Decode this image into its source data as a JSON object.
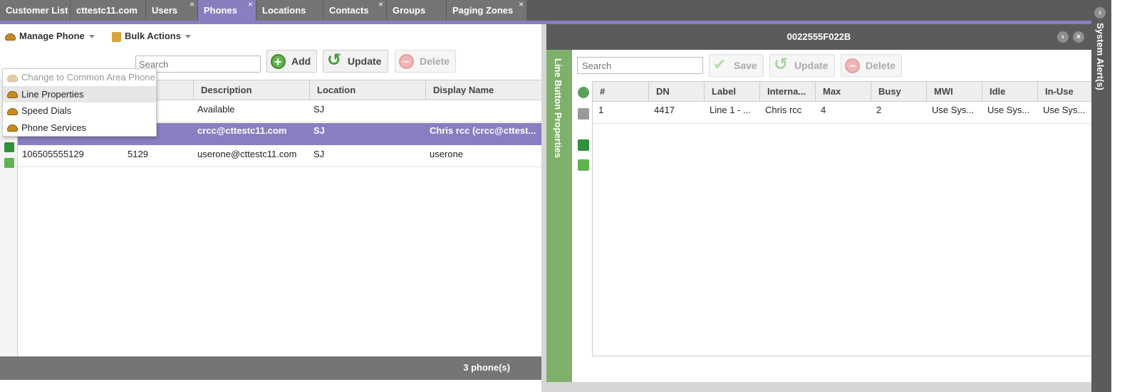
{
  "tabs": [
    {
      "label": "Customer List",
      "closable": false,
      "active": false
    },
    {
      "label": "cttestc11.com",
      "closable": false,
      "active": false
    },
    {
      "label": "Users",
      "closable": true,
      "active": false
    },
    {
      "label": "Phones",
      "closable": true,
      "active": true
    },
    {
      "label": "Locations",
      "closable": false,
      "active": false
    },
    {
      "label": "Contacts",
      "closable": true,
      "active": false
    },
    {
      "label": "Groups",
      "closable": false,
      "active": false
    },
    {
      "label": "Paging Zones",
      "closable": true,
      "active": false
    }
  ],
  "close_glyph": "×",
  "left": {
    "manage_phone": "Manage Phone",
    "bulk_actions": "Bulk Actions",
    "dropdown": [
      {
        "label": "Change to Common Area Phone",
        "disabled": true
      },
      {
        "label": "Line Properties",
        "highlighted": true
      },
      {
        "label": "Speed Dials"
      },
      {
        "label": "Phone Services"
      }
    ],
    "search_placeholder": "Search",
    "add_label": "Add",
    "update_label": "Update",
    "delete_label": "Delete",
    "columns": [
      "Description",
      "Location",
      "Display Name"
    ],
    "rows": [
      {
        "name": "",
        "dn": "",
        "description": "Available",
        "location": "SJ",
        "display_name": "",
        "selected": false
      },
      {
        "name": "0022555F022B",
        "dn": "4417",
        "description": "crcc@cttestc11.com",
        "location": "SJ",
        "display_name": "Chris rcc (crcc@cttest...",
        "selected": true
      },
      {
        "name": "106505555129",
        "dn": "5129",
        "description": "userone@cttestc11.com",
        "location": "SJ",
        "display_name": "userone",
        "selected": false
      }
    ],
    "status": "3 phone(s)"
  },
  "right": {
    "title": "0022555F022B",
    "vertical_label": "Line Button Properties",
    "search_placeholder": "Search",
    "save_label": "Save",
    "update_label": "Update",
    "delete_label": "Delete",
    "columns": [
      "#",
      "DN",
      "Label",
      "Interna...",
      "Max",
      "Busy",
      "MWI",
      "Idle",
      "In-Use"
    ],
    "rows": [
      {
        "num": "1",
        "dn": "4417",
        "label": "Line 1 - ...",
        "internal": "Chris rcc",
        "max": "4",
        "busy": "2",
        "mwi": "Use Sys...",
        "idle": "Use Sys...",
        "inuse": "Use Sys..."
      }
    ]
  },
  "alerts": {
    "label": "System Alert(s)"
  },
  "icons": {
    "phone": "phone-icon",
    "bulk": "bulk-actions-icon",
    "add": "add-icon",
    "update": "update-icon",
    "delete": "delete-icon",
    "save": "save-icon",
    "refresh": "refresh-icon",
    "print": "print-icon",
    "excel": "excel-export-icon",
    "csv": "csv-export-icon",
    "forward": "forward-icon",
    "close": "close-icon",
    "collapse": "collapse-icon"
  },
  "colors": {
    "accent": "#8a7ec1",
    "header_dark": "#5b5b5b",
    "green_bar": "#7fb06b"
  }
}
